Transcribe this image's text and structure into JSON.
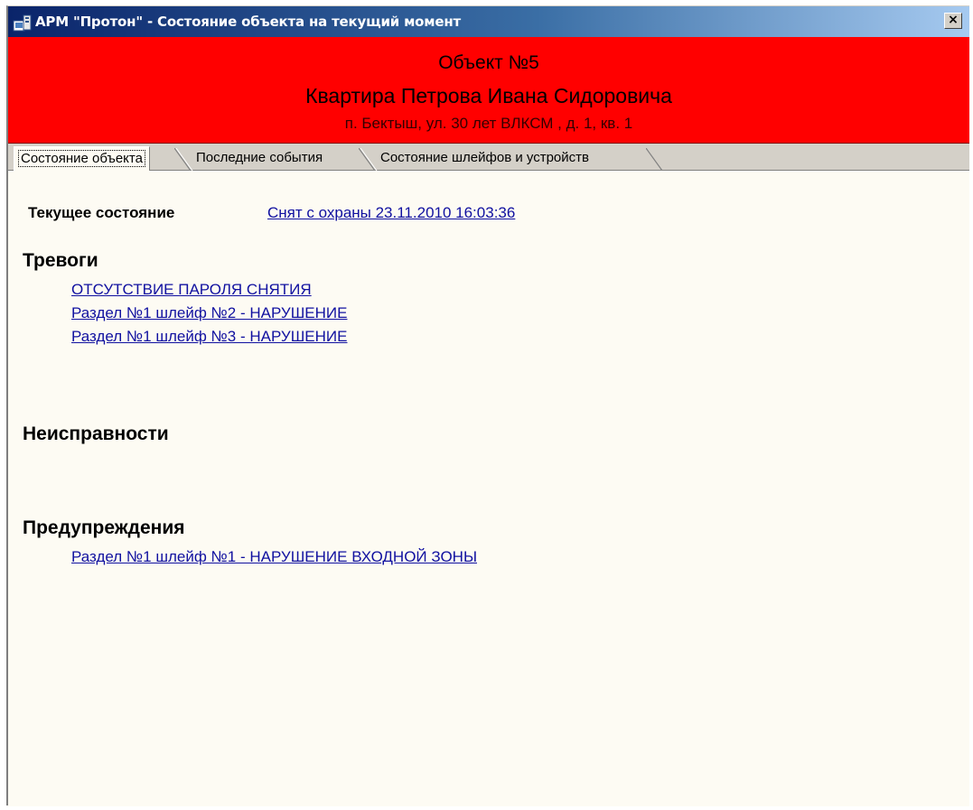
{
  "window": {
    "title": "АРМ \"Протон\" - Состояние объекта на текущий момент",
    "close_label": "×"
  },
  "banner": {
    "object_number": "Объект №5",
    "object_name": "Квартира Петрова Ивана Сидоровича",
    "address": "п. Бектыш, ул. 30 лет ВЛКСМ , д. 1, кв. 1",
    "background_color": "#ff0000"
  },
  "tabs": [
    {
      "label": "Состояние объекта",
      "active": true
    },
    {
      "label": "Последние события",
      "active": false
    },
    {
      "label": "Состояние шлейфов и устройств",
      "active": false
    }
  ],
  "status": {
    "label": "Текущее состояние",
    "value": "Снят с охраны 23.11.2010 16:03:36"
  },
  "sections": {
    "alarms": {
      "heading": "Тревоги",
      "items": [
        "ОТСУТСТВИЕ ПАРОЛЯ СНЯТИЯ",
        "Раздел №1 шлейф №2 - НАРУШЕНИЕ",
        "Раздел №1 шлейф №3 - НАРУШЕНИЕ"
      ]
    },
    "faults": {
      "heading": "Неисправности",
      "items": []
    },
    "warnings": {
      "heading": "Предупреждения",
      "items": [
        "Раздел №1 шлейф №1 - НАРУШЕНИЕ ВХОДНОЙ ЗОНЫ"
      ]
    }
  },
  "icons": {
    "app": "app-icon",
    "close": "close-icon"
  }
}
